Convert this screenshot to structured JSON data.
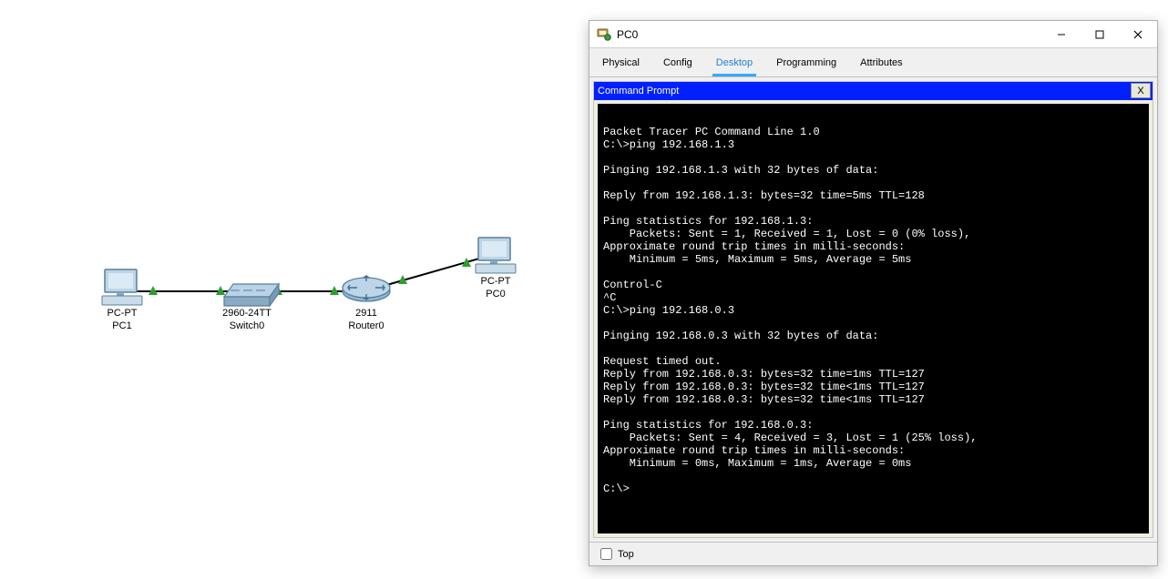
{
  "topology": {
    "devices": {
      "pc1": {
        "label_top": "PC-PT",
        "label_bottom": "PC1"
      },
      "switch0": {
        "label_top": "2960-24TT",
        "label_bottom": "Switch0"
      },
      "router0": {
        "label_top": "2911",
        "label_bottom": "Router0"
      },
      "pc0": {
        "label_top": "PC-PT",
        "label_bottom": "PC0"
      }
    }
  },
  "window": {
    "title": "PC0",
    "tabs": {
      "physical": "Physical",
      "config": "Config",
      "desktop": "Desktop",
      "programming": "Programming",
      "attributes": "Attributes"
    },
    "selected_tab": "desktop",
    "sub_window_title": "Command Prompt",
    "sub_window_close": "X",
    "terminal_text": "\nPacket Tracer PC Command Line 1.0\nC:\\>ping 192.168.1.3\n\nPinging 192.168.1.3 with 32 bytes of data:\n\nReply from 192.168.1.3: bytes=32 time=5ms TTL=128\n\nPing statistics for 192.168.1.3:\n    Packets: Sent = 1, Received = 1, Lost = 0 (0% loss),\nApproximate round trip times in milli-seconds:\n    Minimum = 5ms, Maximum = 5ms, Average = 5ms\n\nControl-C\n^C\nC:\\>ping 192.168.0.3\n\nPinging 192.168.0.3 with 32 bytes of data:\n\nRequest timed out.\nReply from 192.168.0.3: bytes=32 time=1ms TTL=127\nReply from 192.168.0.3: bytes=32 time<1ms TTL=127\nReply from 192.168.0.3: bytes=32 time<1ms TTL=127\n\nPing statistics for 192.168.0.3:\n    Packets: Sent = 4, Received = 3, Lost = 1 (25% loss),\nApproximate round trip times in milli-seconds:\n    Minimum = 0ms, Maximum = 1ms, Average = 0ms\n\nC:\\>",
    "top_checkbox_label": "Top"
  }
}
